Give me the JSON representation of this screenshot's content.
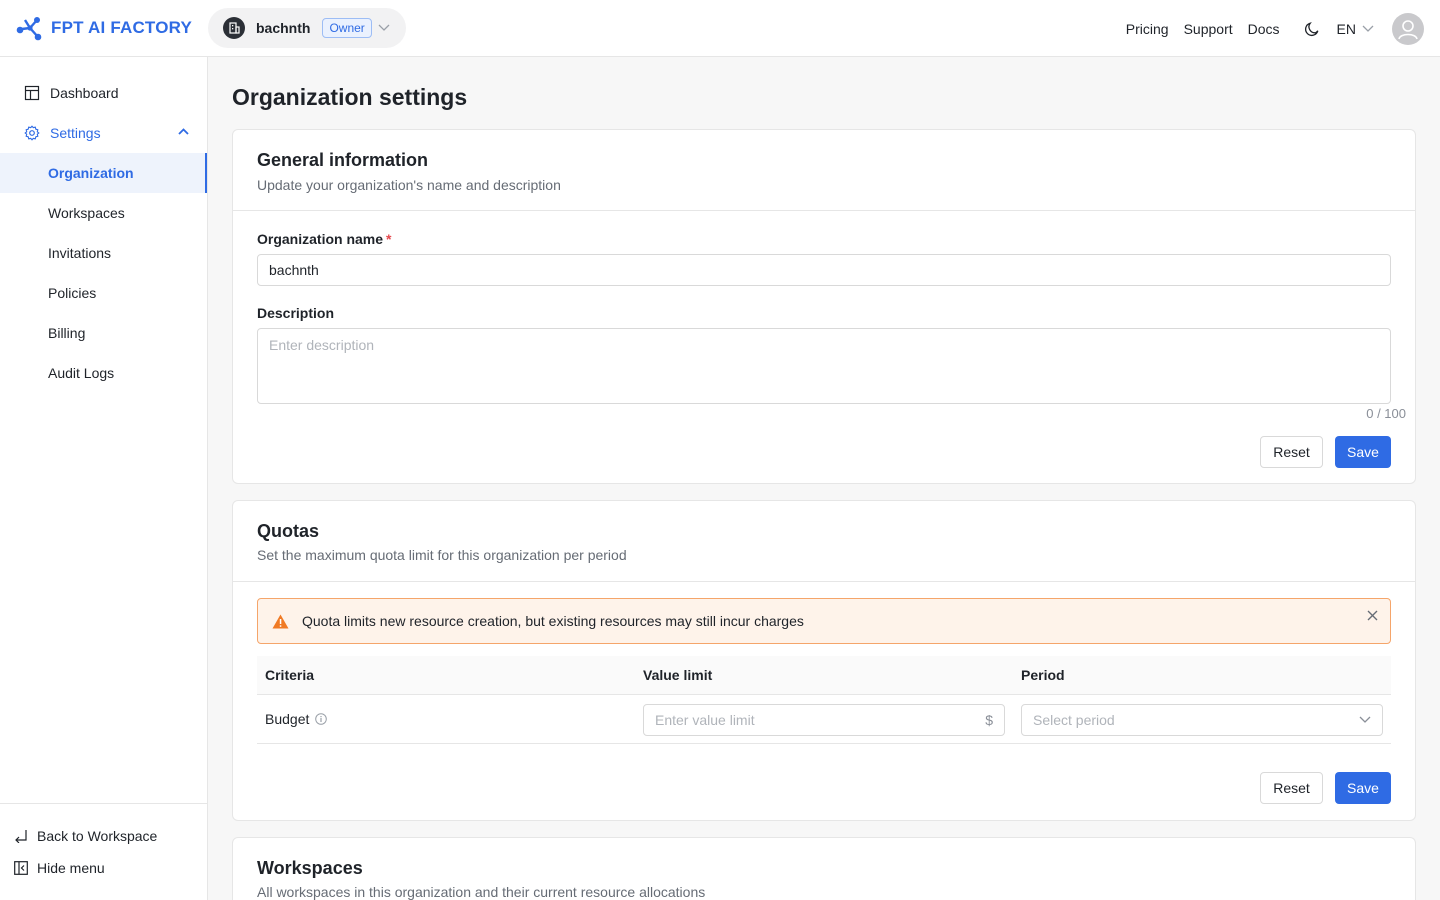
{
  "header": {
    "logo_text": "FPT AI FACTORY",
    "org_name": "bachnth",
    "role_badge": "Owner",
    "links": [
      "Pricing",
      "Support",
      "Docs"
    ],
    "language": "EN",
    "brand_color": "#2f6be4"
  },
  "sidebar": {
    "dashboard": "Dashboard",
    "settings": "Settings",
    "sub_items": [
      "Organization",
      "Workspaces",
      "Invitations",
      "Policies",
      "Billing",
      "Audit Logs"
    ],
    "active_item": "Organization",
    "back_to_workspace": "Back to Workspace",
    "hide_menu": "Hide menu"
  },
  "page": {
    "title": "Organization settings"
  },
  "general": {
    "title": "General information",
    "subtitle": "Update your organization's name and description",
    "name_label": "Organization name",
    "required_mark": "*",
    "name_value": "bachnth",
    "description_label": "Description",
    "description_placeholder": "Enter description",
    "counter": "0 / 100",
    "reset": "Reset",
    "save": "Save"
  },
  "quotas": {
    "title": "Quotas",
    "subtitle": "Set the maximum quota limit for this organization per period",
    "alert": "Quota limits new resource creation, but existing resources may still incur charges",
    "columns": [
      "Criteria",
      "Value limit",
      "Period"
    ],
    "rows": [
      {
        "criteria": "Budget",
        "value_placeholder": "Enter value limit",
        "value_suffix": "$",
        "period_placeholder": "Select period"
      }
    ],
    "reset": "Reset",
    "save": "Save"
  },
  "workspaces": {
    "title": "Workspaces",
    "subtitle": "All workspaces in this organization and their current resource allocations"
  }
}
